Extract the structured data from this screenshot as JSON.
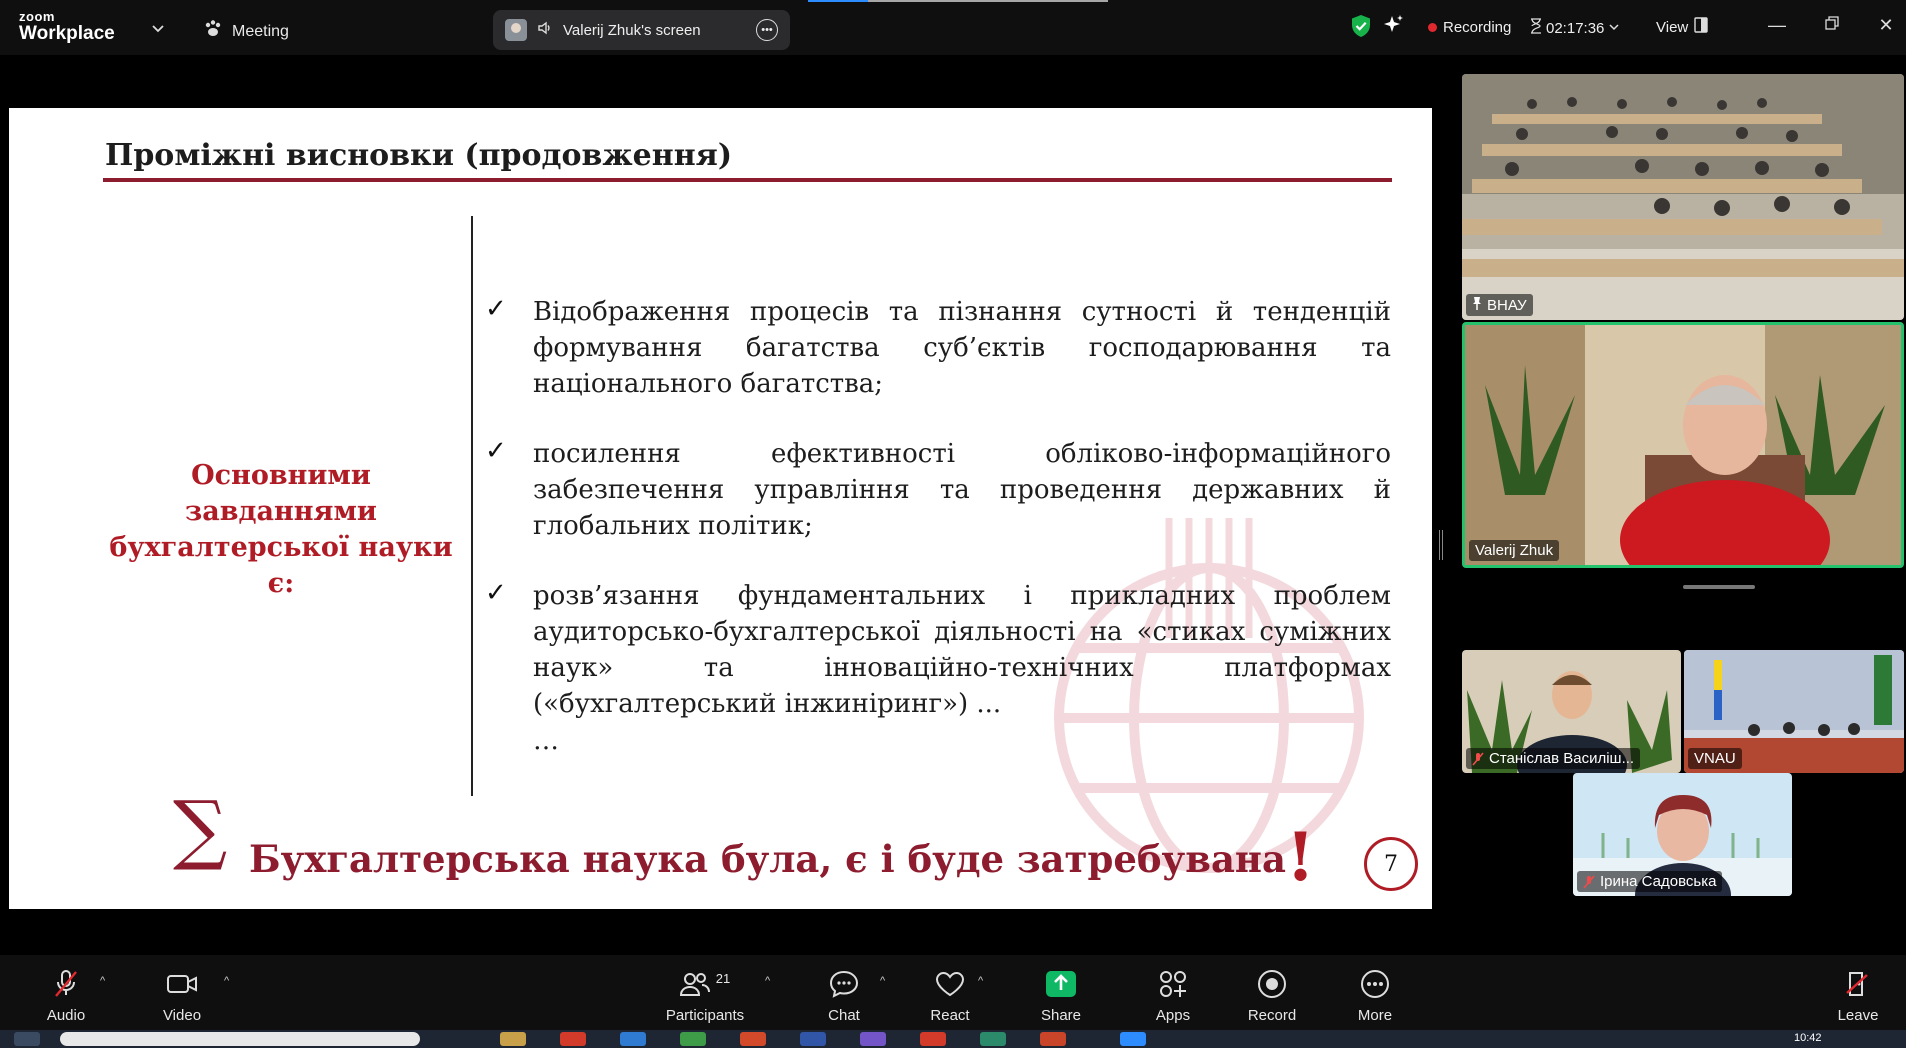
{
  "app": {
    "brand_line1": "zoom",
    "brand_line2": "Workplace",
    "meeting_label": "Meeting",
    "screen_share_label": "Valerij Zhuk's screen",
    "recording_label": "Recording",
    "timer": "02:17:36",
    "view_label": "View"
  },
  "slide": {
    "title": "Проміжні висновки (продовження)",
    "left_label": "Основними завданнями бухгалтерської науки є:",
    "bullets": [
      "Відображення процесів та пізнання сутності й тенденцій формування багатства суб’єктів господарювання та національного багатства;",
      "посилення ефективності обліково-інформаційного забезпечення управління та проведення державних й глобальних політик;",
      "розв’язання фундаментальних і прикладних проблем аудиторсько-бухгалтерської діяльності на «стиках суміжних наук» та інноваційно-технічних платформах («бухгалтерський інжиніринг») ..."
    ],
    "ellipsis": "…",
    "sigma": "∑",
    "conclusion": "Бухгалтерська наука була, є і буде затребувана",
    "conclusion_mark": "!",
    "page_number": "7",
    "accent_color": "#8d1c2e"
  },
  "participants_panel": {
    "tiles": [
      {
        "name": "ВНАУ",
        "pinned": true
      },
      {
        "name": "Valerij Zhuk",
        "active_speaker": true
      },
      {
        "name": "Станіслав Василіш...",
        "muted": true
      },
      {
        "name": "VNAU"
      },
      {
        "name": "Ірина Садовська",
        "muted": true
      }
    ]
  },
  "toolbar": {
    "audio": "Audio",
    "video": "Video",
    "participants": "Participants",
    "participants_count": "21",
    "chat": "Chat",
    "react": "React",
    "share": "Share",
    "apps": "Apps",
    "record": "Record",
    "more": "More",
    "leave": "Leave"
  },
  "taskbar": {
    "clock": "10:42"
  },
  "colors": {
    "share_green": "#0fb865",
    "record_red": "#e0282e",
    "active_speaker_border": "#25c26e"
  }
}
